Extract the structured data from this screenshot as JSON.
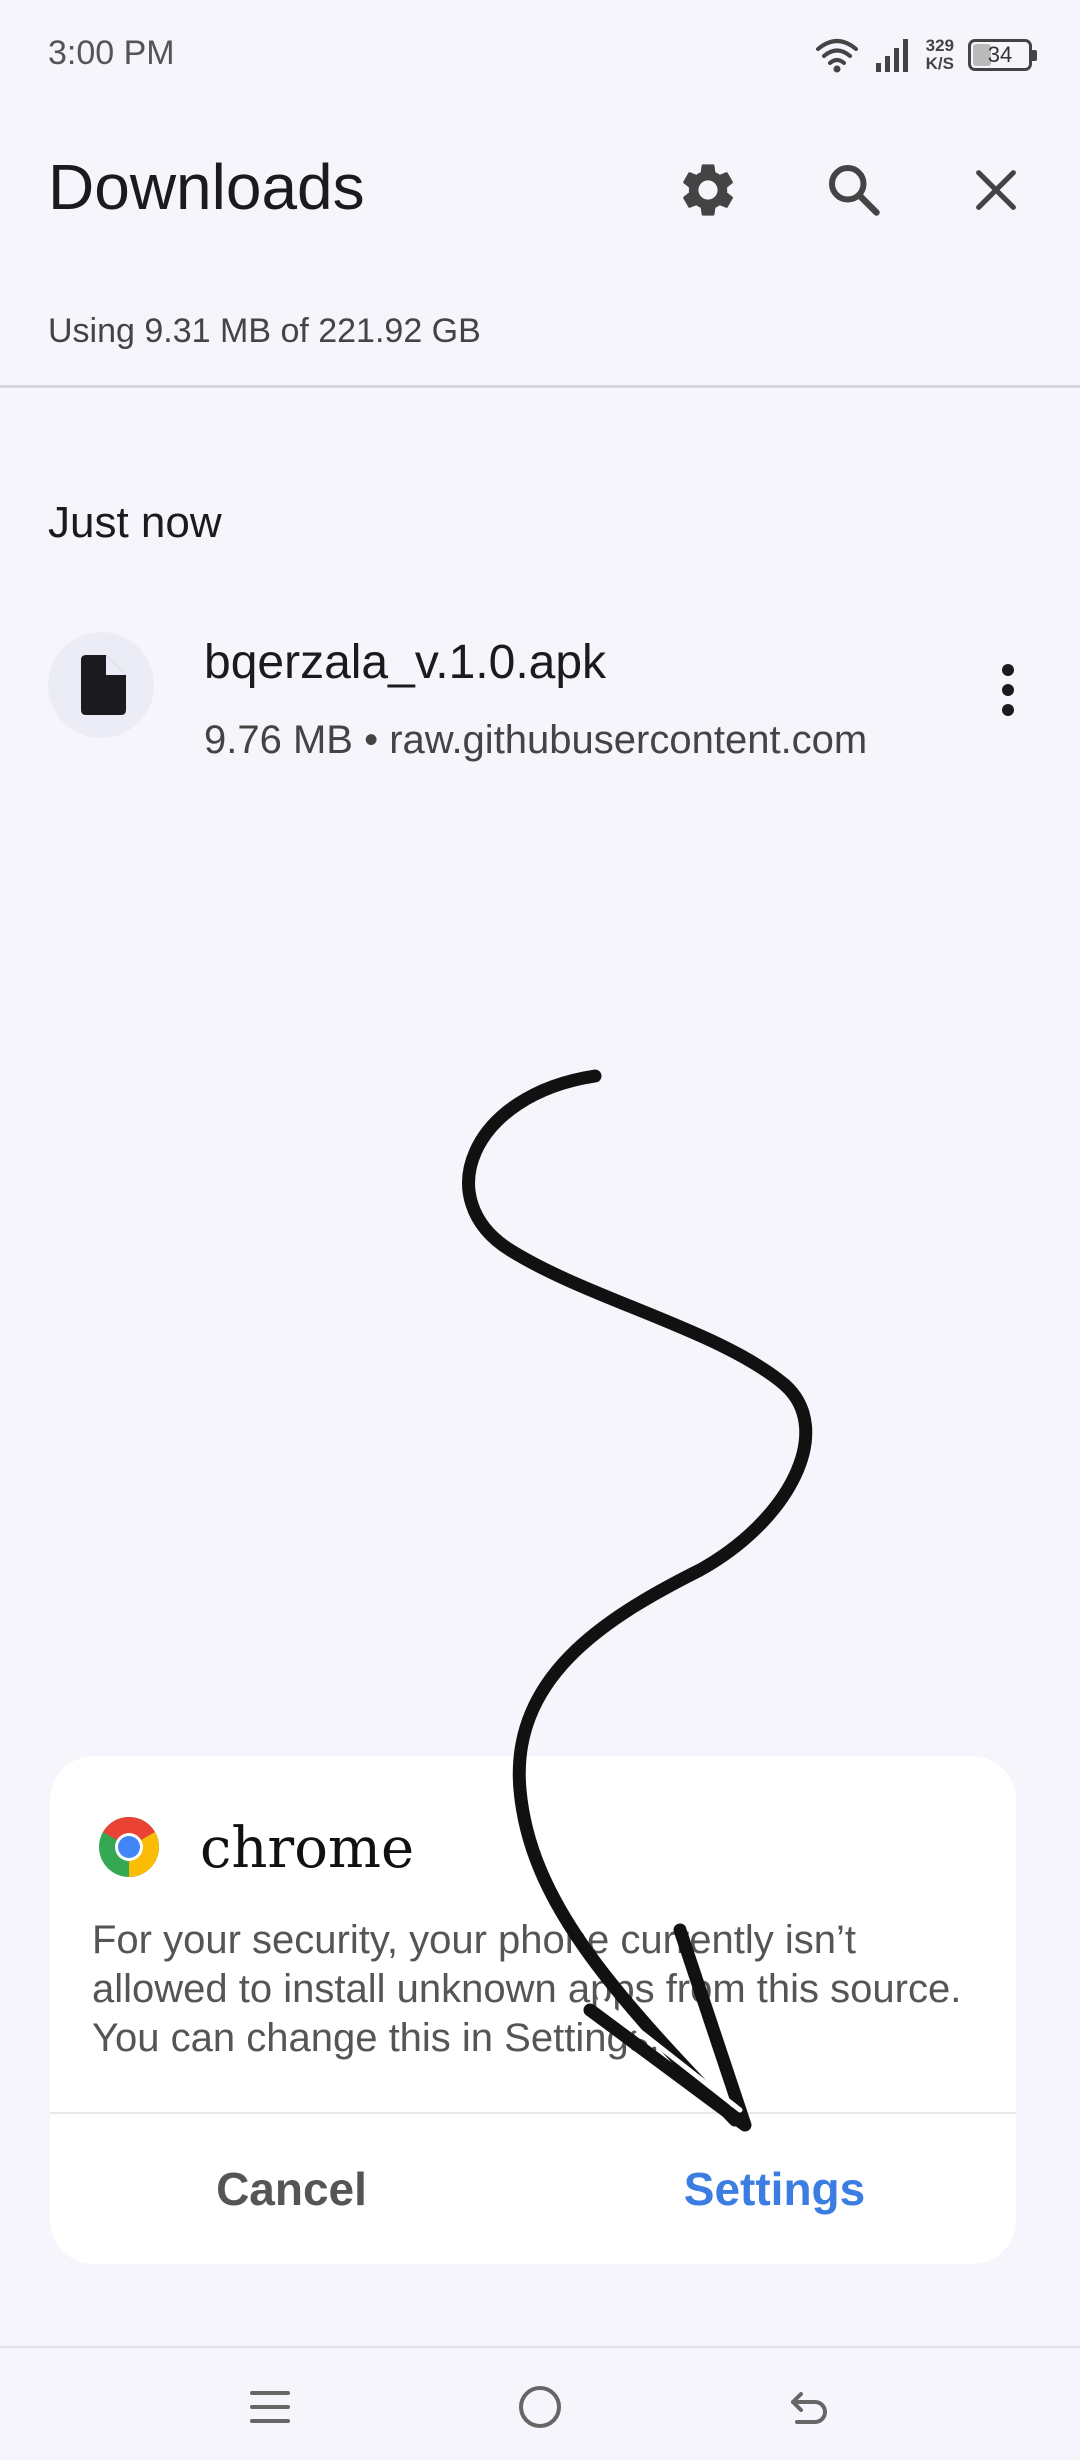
{
  "status_bar": {
    "time": "3:00 PM",
    "net_speed_value": "329",
    "net_speed_unit": "K/S",
    "battery": "34",
    "battery_level": 0.34
  },
  "header": {
    "title": "Downloads",
    "settings_icon": "gear-icon",
    "search_icon": "search-icon",
    "close_icon": "close-icon"
  },
  "storage_text": "Using 9.31 MB of 221.92 GB",
  "section_label": "Just now",
  "download_item": {
    "file_name": "bqerzala_v.1.0.apk",
    "meta": "9.76 MB • raw.githubusercontent.com",
    "icon": "file-icon",
    "more_icon": "more-vert-icon"
  },
  "dialog": {
    "app_name": "chrome",
    "app_icon": "chrome-icon",
    "message": "For your security, your phone currently isn’t allowed to install unknown apps from this source. You can change this in Settings.",
    "cancel_label": "Cancel",
    "settings_label": "Settings",
    "accent_color": "#3b7de1"
  },
  "nav_bar": {
    "menu_icon": "menu-icon",
    "home_icon": "home-circle-icon",
    "back_icon": "back-icon"
  }
}
